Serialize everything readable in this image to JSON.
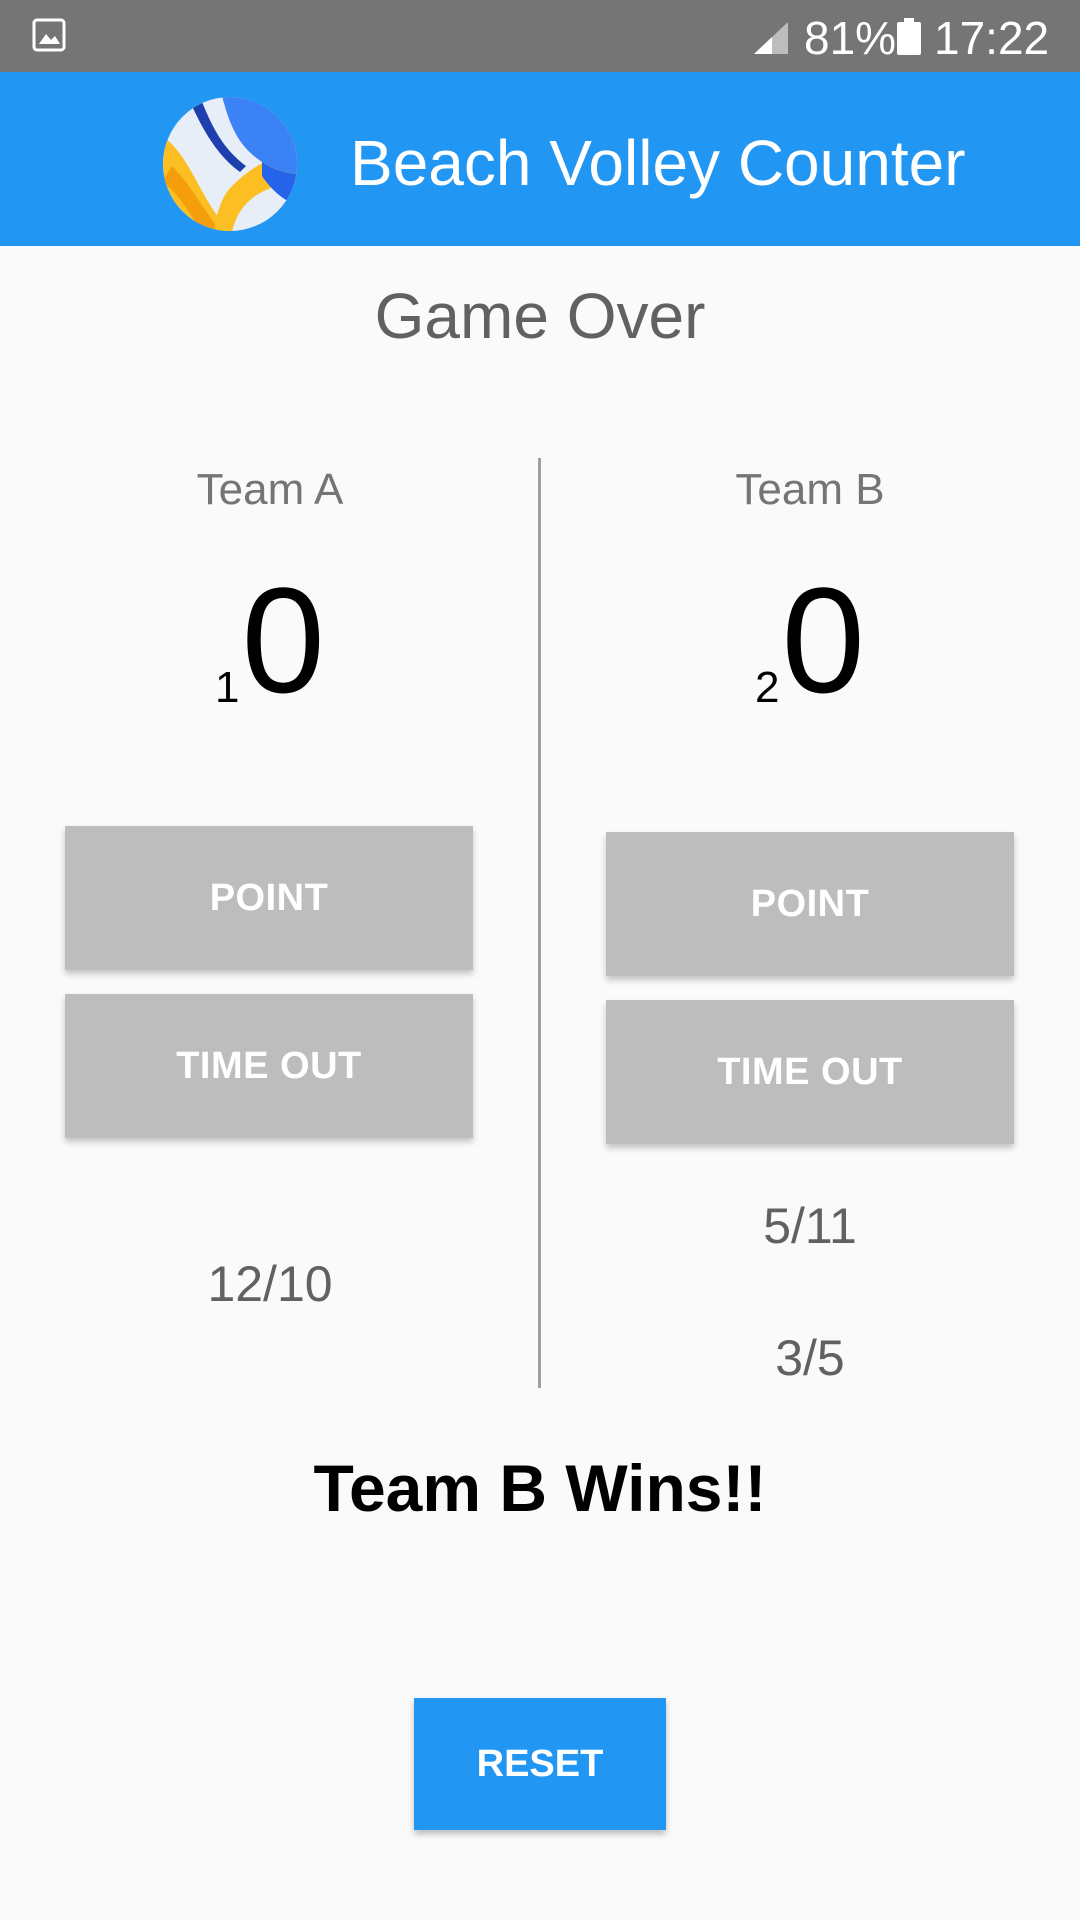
{
  "status_bar": {
    "battery": "81%",
    "time": "17:22",
    "icons": [
      "image-icon",
      "signal-icon",
      "battery-icon"
    ]
  },
  "app_bar": {
    "title": "Beach Volley Counter",
    "logo": "volleyball-logo"
  },
  "game_status": "Game Over",
  "team_a": {
    "name": "Team A",
    "sets_won": "1",
    "score": "0",
    "point_label": "POINT",
    "timeout_label": "TIME OUT",
    "set_scores": [
      "12/10"
    ]
  },
  "team_b": {
    "name": "Team B",
    "sets_won": "2",
    "score": "0",
    "point_label": "POINT",
    "timeout_label": "TIME OUT",
    "set_scores": [
      "5/11",
      "3/5"
    ]
  },
  "winner_text": "Team B Wins!!",
  "reset_label": "RESET",
  "colors": {
    "primary": "#2196f3",
    "status_bar": "#757575",
    "button_disabled": "#bdbdbd",
    "background": "#fafafa"
  }
}
